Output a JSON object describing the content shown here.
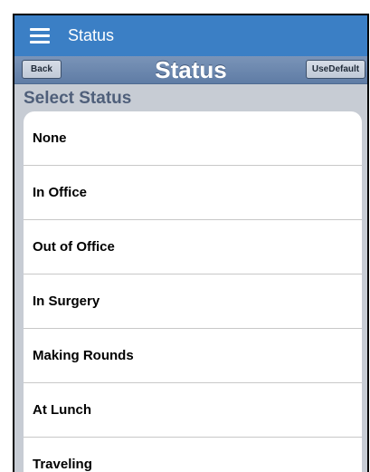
{
  "appbar": {
    "title": "Status",
    "menu_icon": "hamburger-menu-icon"
  },
  "navbar": {
    "back_label": "Back",
    "title": "Status",
    "use_default_label": "UseDefault"
  },
  "section": {
    "header": "Select Status"
  },
  "status_options": [
    "None",
    "In Office",
    "Out of Office",
    "In Surgery",
    "Making Rounds",
    "At Lunch",
    "Traveling"
  ],
  "colors": {
    "appbar": "#3b7fc5",
    "navbar": "#6a87b0",
    "background": "#c7ccd4",
    "section_header_text": "#4f5f7a"
  }
}
